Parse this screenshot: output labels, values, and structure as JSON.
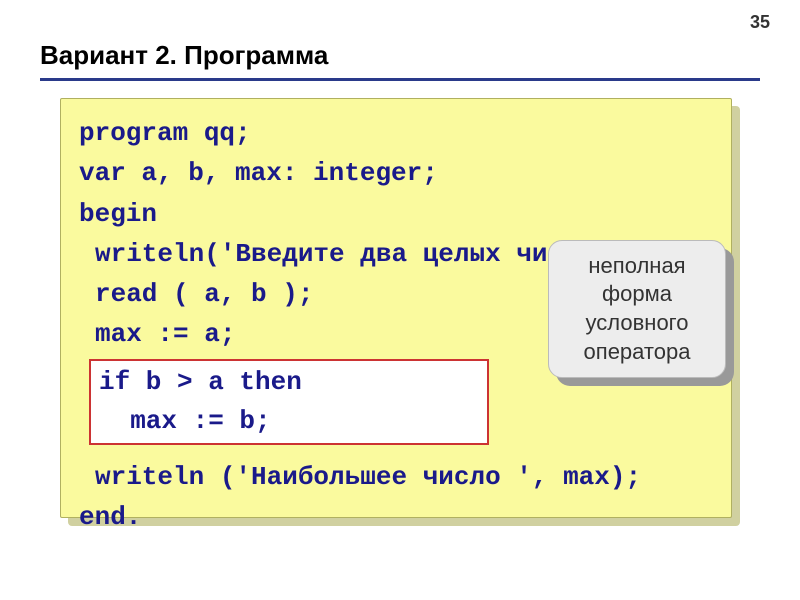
{
  "page_number": "35",
  "title": "Вариант 2. Программа",
  "code": {
    "line1": "program qq;",
    "line2": "var a, b, max: integer;",
    "line3": "begin",
    "line4": "writeln('Введите два целых числа');",
    "line5": "read ( a, b );",
    "line6": "max := a;",
    "line7": "if b > a then",
    "line8": "  max := b;",
    "line9": "writeln ('Наибольшее число ', max);",
    "line10": "end."
  },
  "callout_text": "неполная форма условного оператора"
}
